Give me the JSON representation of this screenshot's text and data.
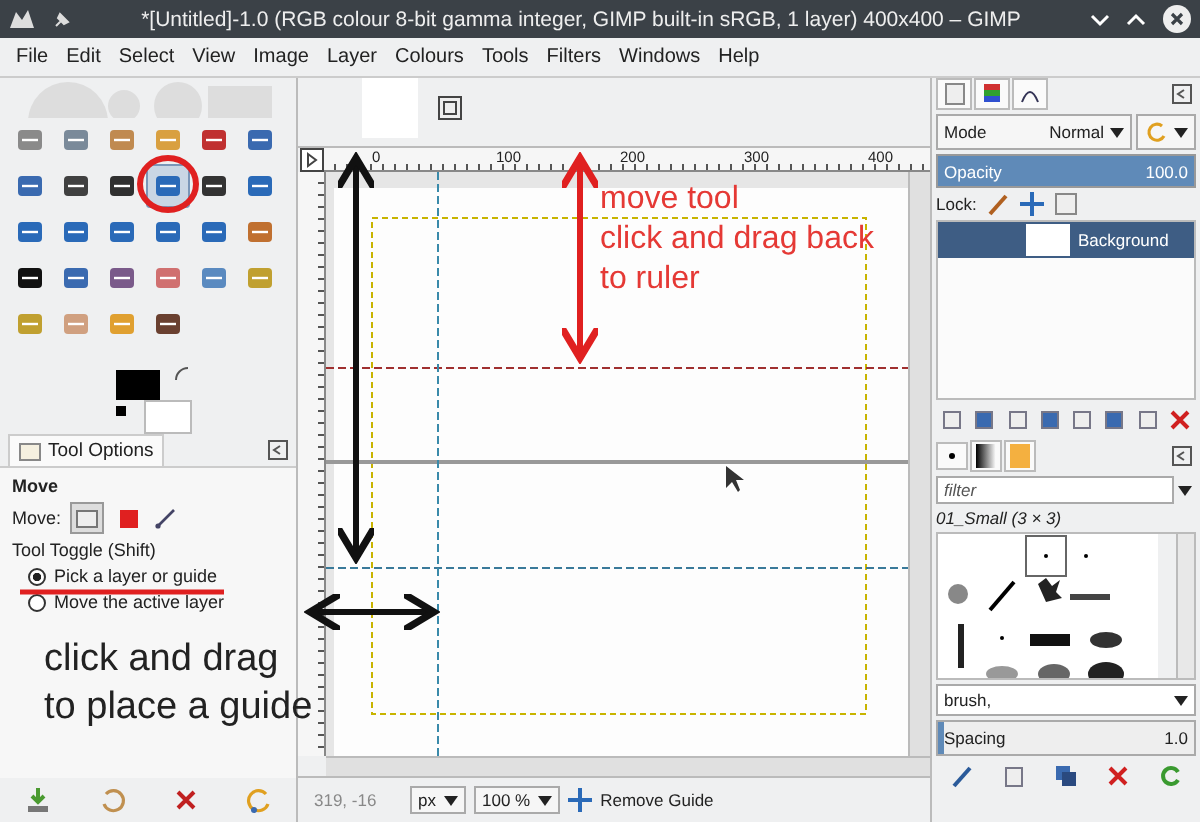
{
  "window": {
    "title": "*[Untitled]-1.0 (RGB colour 8-bit gamma integer, GIMP built-in sRGB, 1 layer) 400x400 – GIMP"
  },
  "menu": [
    "File",
    "Edit",
    "Select",
    "View",
    "Image",
    "Layer",
    "Colours",
    "Tools",
    "Filters",
    "Windows",
    "Help"
  ],
  "toolbox": {
    "tools": [
      {
        "selected": false
      },
      {
        "selected": false
      },
      {
        "selected": false
      },
      {
        "selected": false
      },
      {
        "selected": false
      },
      {
        "selected": false
      },
      {
        "selected": false
      },
      {
        "selected": false
      },
      {
        "selected": false
      },
      {
        "selected": true
      },
      {
        "selected": false
      },
      {
        "selected": false
      },
      {
        "selected": false
      },
      {
        "selected": false
      },
      {
        "selected": false
      },
      {
        "selected": false
      },
      {
        "selected": false
      },
      {
        "selected": false
      },
      {
        "selected": false
      },
      {
        "selected": false
      },
      {
        "selected": false
      },
      {
        "selected": false
      },
      {
        "selected": false
      },
      {
        "selected": false
      },
      {
        "selected": false
      },
      {
        "selected": false
      },
      {
        "selected": false
      },
      {
        "selected": false
      }
    ]
  },
  "tool_options": {
    "tab": "Tool Options",
    "tool": "Move",
    "move_label": "Move:",
    "toggle_label": "Tool Toggle  (Shift)",
    "options": [
      {
        "label": "Pick a layer or guide",
        "selected": true
      },
      {
        "label": "Move the active layer",
        "selected": false
      }
    ]
  },
  "canvas": {
    "ruler_labels": [
      "0",
      "100",
      "200",
      "300",
      "400"
    ]
  },
  "status_bar": {
    "coords": "319, -16",
    "unit": "px",
    "zoom": "100 %",
    "message": "Remove Guide"
  },
  "layers": {
    "mode_label": "Mode",
    "mode": "Normal",
    "opacity_label": "Opacity",
    "opacity": "100.0",
    "level": 1,
    "lock_label": "Lock:",
    "items": [
      {
        "name": "Background",
        "selected": true
      }
    ]
  },
  "brushes": {
    "filter_placeholder": "filter",
    "brush_name": "01_Small (3 × 3)",
    "tag_field": "brush,",
    "spacing_label": "Spacing",
    "spacing": "1.0",
    "level": 0.02
  },
  "annotations": [
    {
      "kind": "red",
      "lines": [
        "move tool",
        "click and drag back",
        "to ruler"
      ]
    },
    {
      "kind": "black",
      "lines": [
        "click and drag",
        "to place a guide"
      ]
    }
  ]
}
